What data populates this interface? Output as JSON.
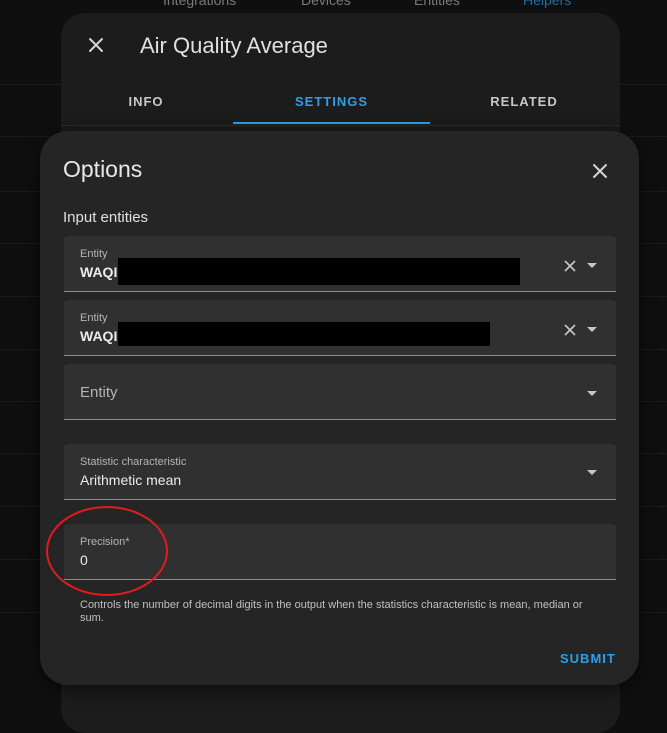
{
  "background": {
    "tabs": [
      {
        "label": "Integrations",
        "active": false
      },
      {
        "label": "Devices",
        "active": false
      },
      {
        "label": "Entities",
        "active": false
      },
      {
        "label": "Helpers",
        "active": true
      }
    ]
  },
  "dialog": {
    "title": "Air Quality Average",
    "close_icon": "close-icon",
    "tabs": [
      {
        "label": "INFO",
        "active": false
      },
      {
        "label": "SETTINGS",
        "active": true
      },
      {
        "label": "RELATED",
        "active": false
      }
    ]
  },
  "options": {
    "title": "Options",
    "close_icon": "close-icon",
    "input_entities_label": "Input entities",
    "entities": [
      {
        "label": "Entity",
        "value": "WAQI",
        "redacted": true
      },
      {
        "label": "Entity",
        "value": "WAQI",
        "redacted": true
      }
    ],
    "empty_entity_placeholder": "Entity",
    "statistic": {
      "label": "Statistic characteristic",
      "value": "Arithmetic mean"
    },
    "precision": {
      "label": "Precision*",
      "value": "0"
    },
    "precision_helper": "Controls the number of decimal digits in the output when the statistics characteristic is mean, median or sum.",
    "submit_label": "SUBMIT"
  },
  "colors": {
    "accent": "#2f9ee8",
    "annotation": "#e01c1c"
  }
}
